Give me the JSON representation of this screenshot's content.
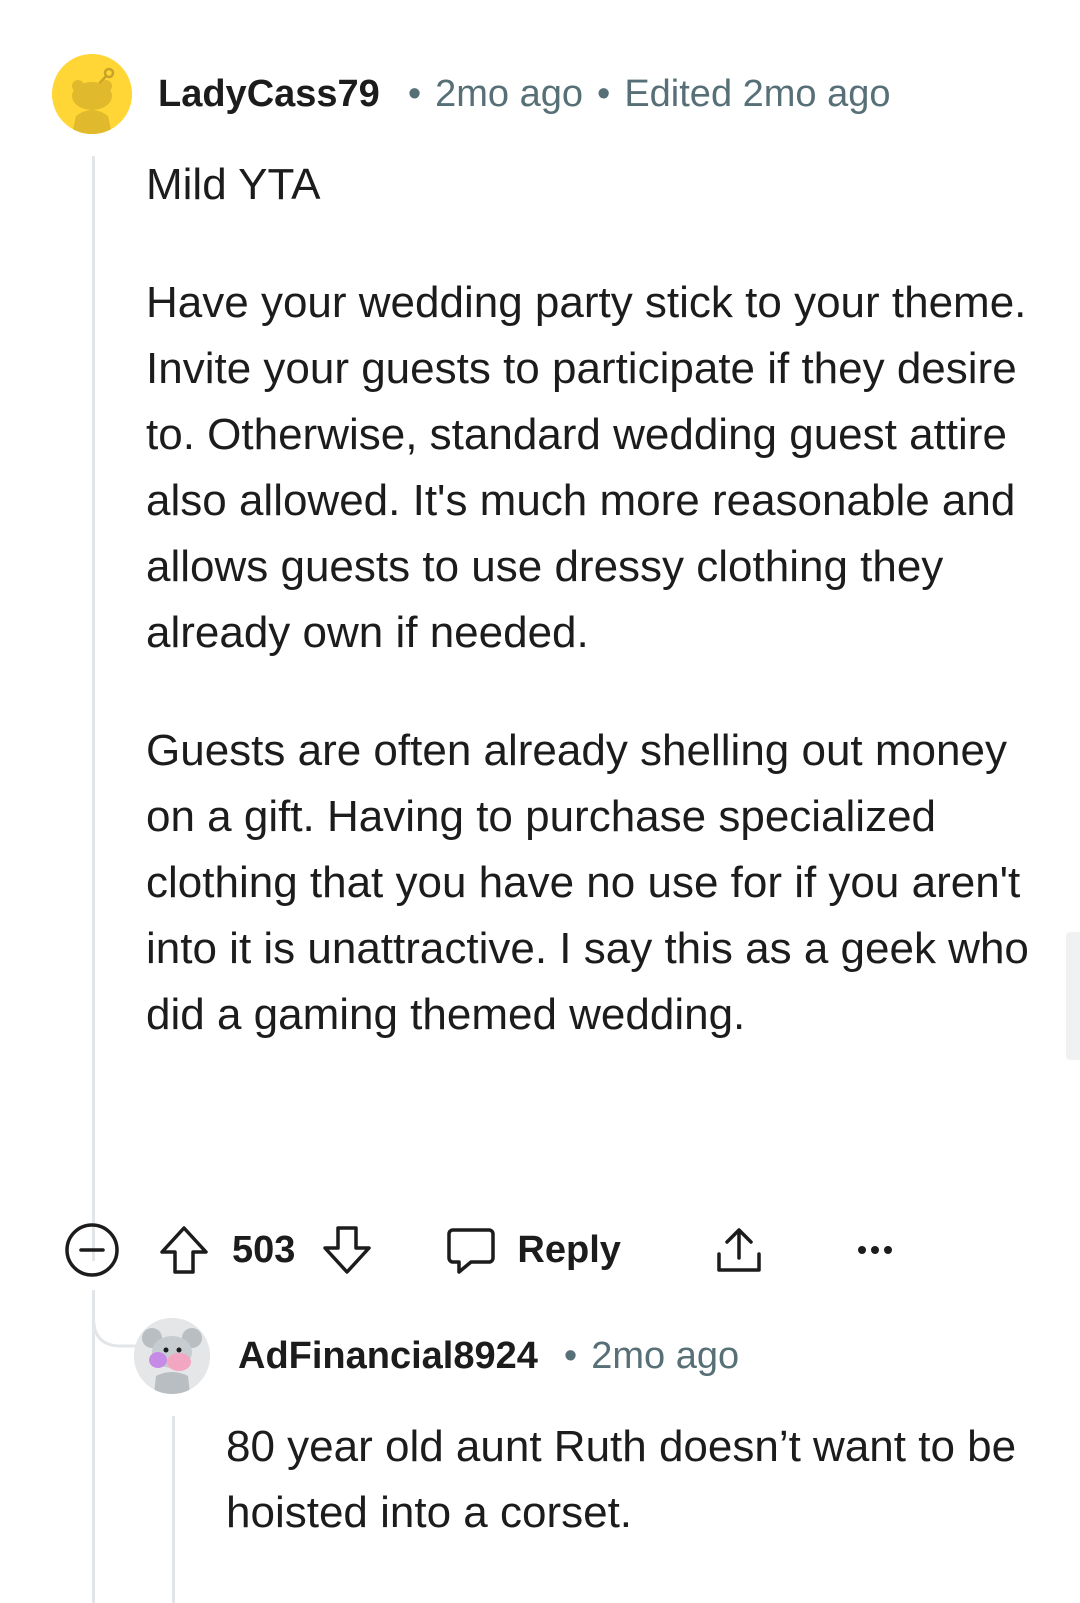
{
  "comment": {
    "username": "LadyCass79",
    "time": "2mo ago",
    "edited": "Edited 2mo ago",
    "paragraphs": [
      "Mild YTA",
      "Have your wedding party stick to your theme. Invite your guests to participate if they desire to. Otherwise, standard wedding guest attire also allowed. It's much more reasonable and allows guests to use dressy clothing they already own if needed.",
      "Guests are often already shelling out money on a gift. Having to purchase specialized clothing that you have no use for if you aren't into it is unattractive. I say this as a geek who did a gaming themed wedding."
    ],
    "vote_count": "503",
    "reply_label": "Reply",
    "avatar_icon": "snoo-yellow-avatar",
    "accent_color": "#ffd635"
  },
  "reply": {
    "username": "AdFinancial8924",
    "time": "2mo ago",
    "text": "80 year old aunt Ruth doesn’t want to be hoisted into a corset.",
    "avatar_icon": "snoo-koala-avatar"
  }
}
